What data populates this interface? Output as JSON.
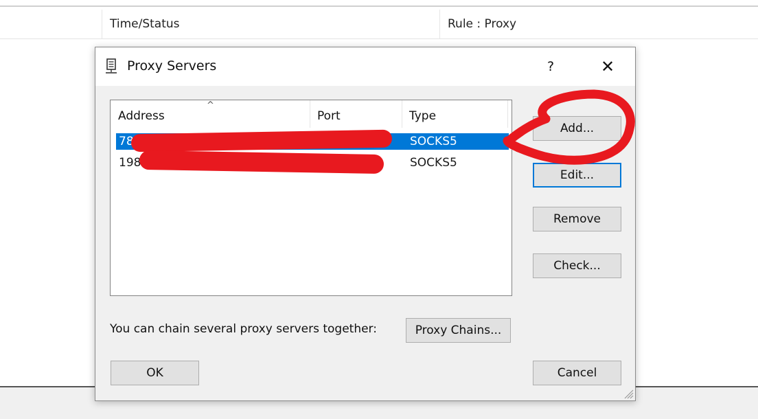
{
  "background": {
    "columns": [
      "Time/Status",
      "Rule : Proxy"
    ]
  },
  "dialog": {
    "title": "Proxy Servers",
    "help_label": "?",
    "close_label": "✕",
    "list": {
      "columns": [
        "Address",
        "Port",
        "Type"
      ],
      "sort_indicator": "^",
      "rows": [
        {
          "address": "78",
          "port": "",
          "type": "SOCKS5",
          "selected": true
        },
        {
          "address": "198",
          "port": "",
          "type": "SOCKS5",
          "selected": false
        }
      ]
    },
    "buttons": {
      "add": "Add...",
      "edit": "Edit...",
      "remove": "Remove",
      "check": "Check...",
      "proxy_chains": "Proxy Chains...",
      "ok": "OK",
      "cancel": "Cancel"
    },
    "chain_text": "You can chain several proxy servers together:"
  },
  "colors": {
    "selection": "#0078d7",
    "annotation_red": "#e8191f",
    "dialog_bg": "#f0f0f0"
  },
  "icons": {
    "title": "server-icon",
    "help": "help-icon",
    "close": "close-icon"
  }
}
